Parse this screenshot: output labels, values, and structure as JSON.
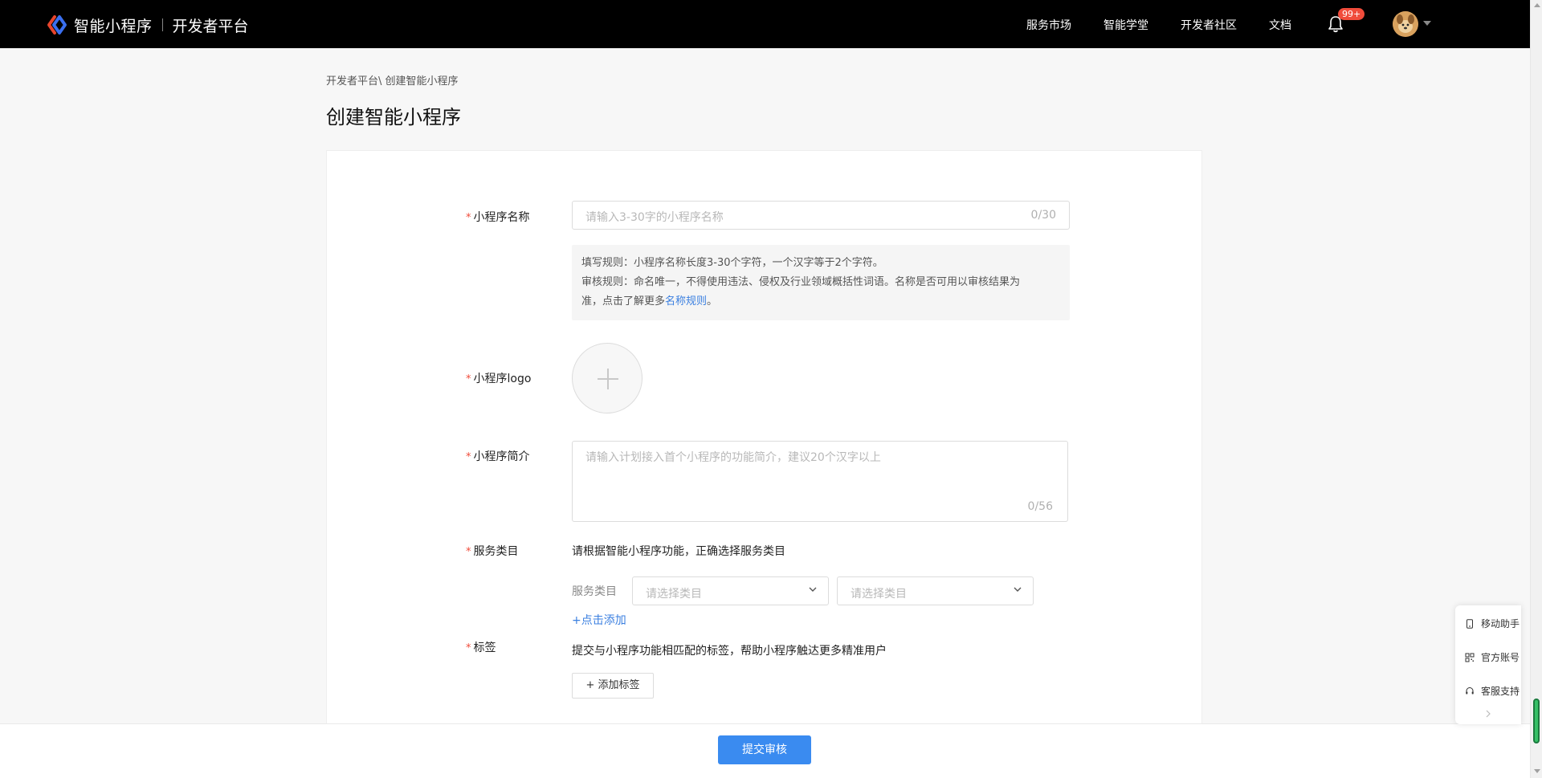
{
  "header": {
    "brand_name": "智能小程序",
    "brand_sub": "开发者平台",
    "nav": [
      "服务市场",
      "智能学堂",
      "开发者社区",
      "文档"
    ],
    "notification_count": "99+",
    "icons": [
      "bell-icon",
      "avatar",
      "caret-down-icon"
    ]
  },
  "breadcrumb": {
    "parent": "开发者平台\\",
    "current": " 创建智能小程序"
  },
  "page_title": "创建智能小程序",
  "form": {
    "name": {
      "label": "小程序名称",
      "placeholder": "请输入3-30字的小程序名称",
      "counter": "0/30"
    },
    "rules": {
      "line1": "填写规则：小程序名称长度3-30个字符，一个汉字等于2个字符。",
      "line2": "审核规则：命名唯一，不得使用违法、侵权及行业领域概括性词语。名称是否可用以审核结果为",
      "line3_prefix": "准，点击了解更多",
      "line3_link": "名称规则",
      "line3_suffix": "。"
    },
    "logo": {
      "label": "小程序logo"
    },
    "intro": {
      "label": "小程序简介",
      "placeholder": "请输入计划接入首个小程序的功能简介，建议20个汉字以上",
      "counter": "0/56"
    },
    "category": {
      "label": "服务类目",
      "hint": "请根据智能小程序功能，正确选择服务类目",
      "sub_label": "服务类目",
      "select1_placeholder": "请选择类目",
      "select2_placeholder": "请选择类目",
      "add_link": "+点击添加"
    },
    "tags": {
      "label": "标签",
      "hint": "提交与小程序功能相匹配的标签，帮助小程序触达更多精准用户",
      "add_button": "+ 添加标签"
    },
    "required_mark": "*"
  },
  "footer": {
    "submit": "提交审核"
  },
  "helper": {
    "items": [
      "移动助手",
      "官方账号",
      "客服支持"
    ]
  },
  "colors": {
    "accent": "#3a8bf0",
    "link": "#3a7fe0",
    "required": "#f04c3b",
    "topbar": "#000000"
  }
}
